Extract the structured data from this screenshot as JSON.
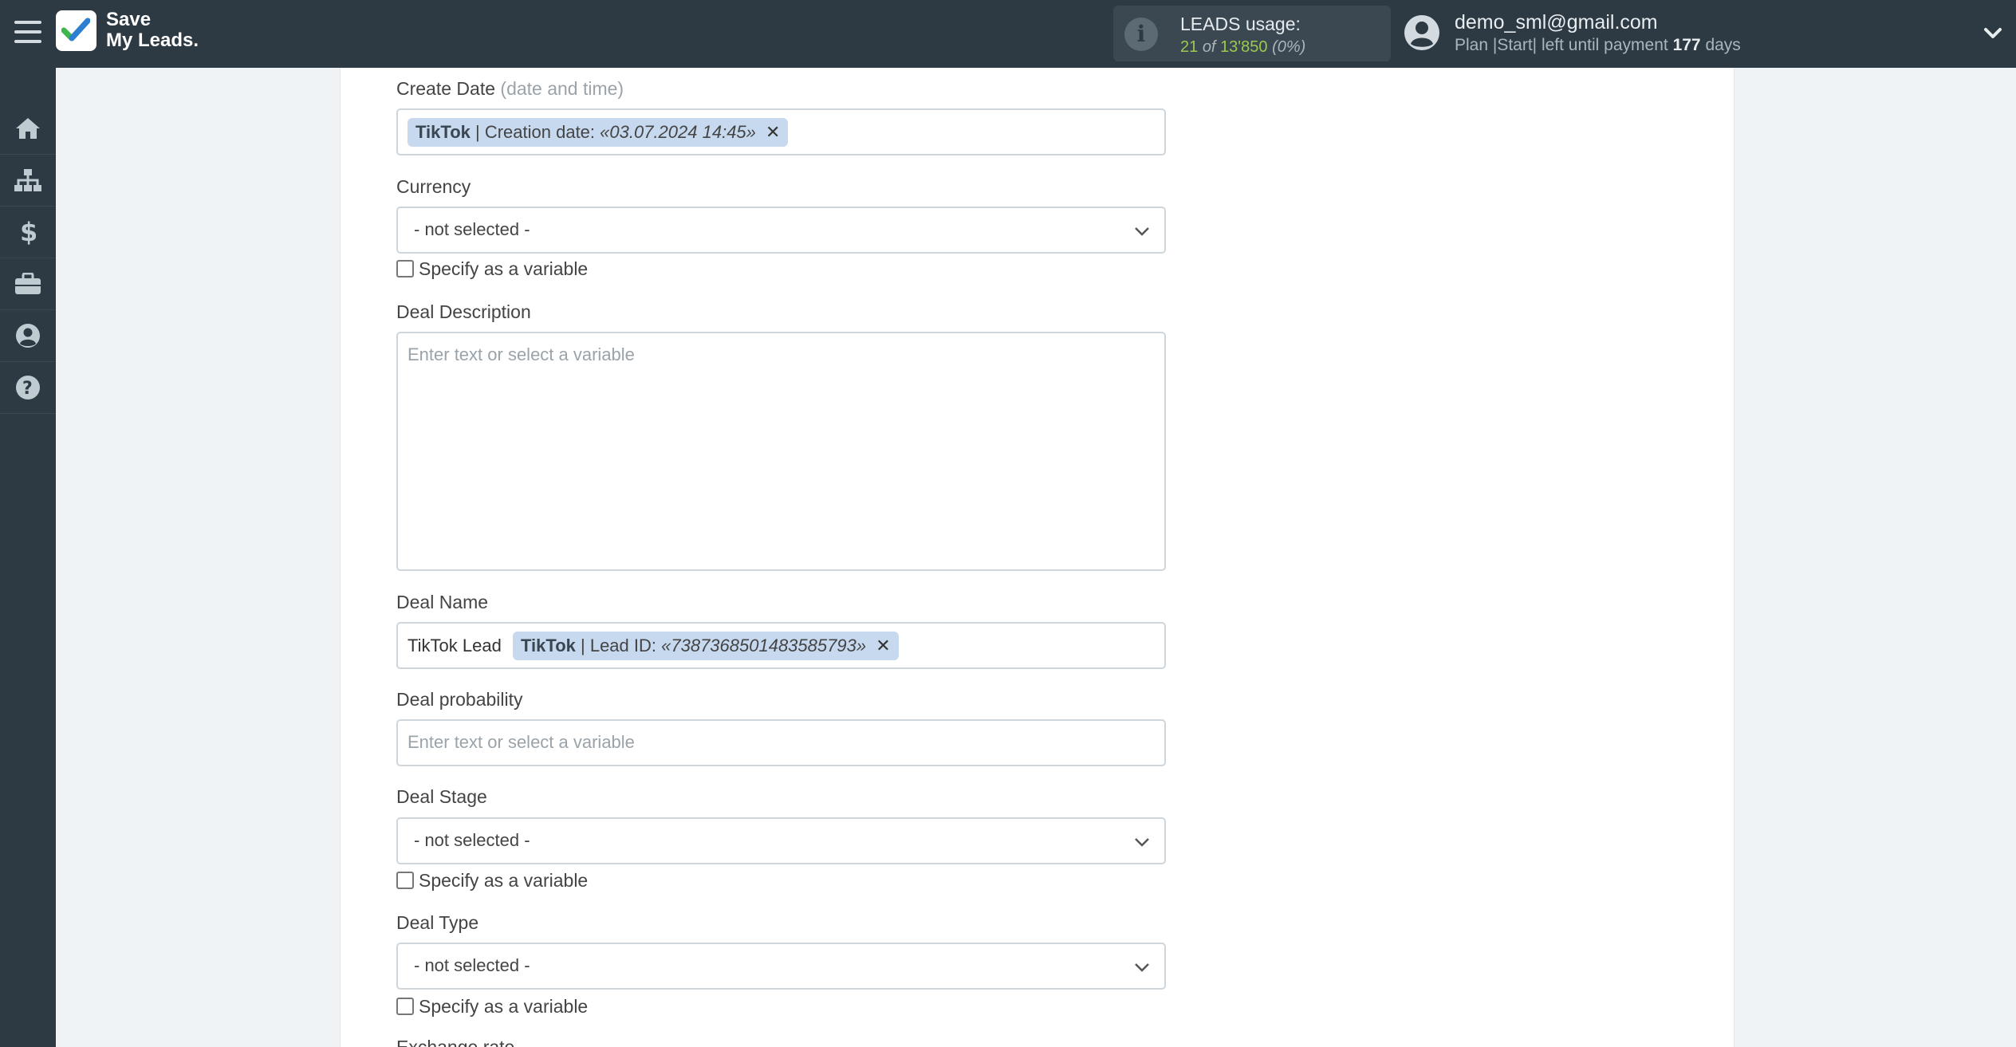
{
  "header": {
    "logo_line1": "Save",
    "logo_line2": "My Leads.",
    "usage_label": "LEADS usage:",
    "usage_used": "21",
    "usage_of": "of",
    "usage_total": "13'850",
    "usage_pct": "(0%)",
    "user_email": "demo_sml@gmail.com",
    "plan_text": "Plan |Start| left until payment",
    "plan_days": "177",
    "plan_days_unit": "days"
  },
  "sidebar": {
    "items": [
      "home-icon",
      "sitemap-icon",
      "dollar-icon",
      "briefcase-icon",
      "user-circle-icon",
      "question-circle-icon"
    ]
  },
  "form": {
    "create_date": {
      "label": "Create Date",
      "hint": "(date and time)",
      "tag_source": "TikTok",
      "tag_text": "| Creation date:",
      "tag_value": "«03.07.2024 14:45»"
    },
    "currency": {
      "label": "Currency",
      "value": "- not selected -",
      "checkbox_label": "Specify as a variable"
    },
    "deal_description": {
      "label": "Deal Description",
      "placeholder": "Enter text or select a variable"
    },
    "deal_name": {
      "label": "Deal Name",
      "prefix_text": "TikTok Lead",
      "tag_source": "TikTok",
      "tag_text": "| Lead ID:",
      "tag_value": "«7387368501483585793»"
    },
    "deal_probability": {
      "label": "Deal probability",
      "placeholder": "Enter text or select a variable"
    },
    "deal_stage": {
      "label": "Deal Stage",
      "value": "- not selected -",
      "checkbox_label": "Specify as a variable"
    },
    "deal_type": {
      "label": "Deal Type",
      "value": "- not selected -",
      "checkbox_label": "Specify as a variable"
    },
    "next_label_partial": "Exchange rate"
  },
  "colors": {
    "topbar": "#2d3943",
    "accent_green": "#9bc94f",
    "tag_bg": "#c7d9ef"
  }
}
